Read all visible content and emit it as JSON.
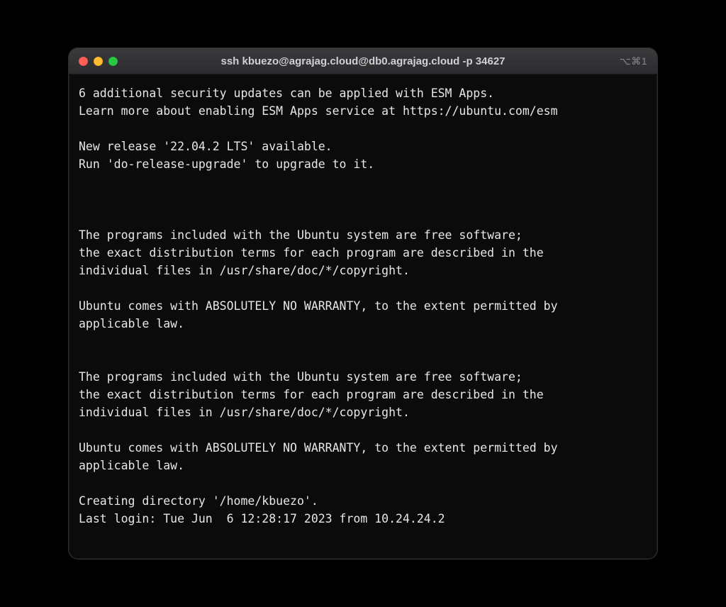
{
  "window": {
    "title": "ssh kbuezo@agrajag.cloud@db0.agrajag.cloud -p 34627",
    "shortcut_hint": "⌥⌘1"
  },
  "terminal": {
    "lines": [
      "6 additional security updates can be applied with ESM Apps.",
      "Learn more about enabling ESM Apps service at https://ubuntu.com/esm",
      "",
      "New release '22.04.2 LTS' available.",
      "Run 'do-release-upgrade' to upgrade to it.",
      "",
      "",
      "",
      "The programs included with the Ubuntu system are free software;",
      "the exact distribution terms for each program are described in the",
      "individual files in /usr/share/doc/*/copyright.",
      "",
      "Ubuntu comes with ABSOLUTELY NO WARRANTY, to the extent permitted by",
      "applicable law.",
      "",
      "",
      "The programs included with the Ubuntu system are free software;",
      "the exact distribution terms for each program are described in the",
      "individual files in /usr/share/doc/*/copyright.",
      "",
      "Ubuntu comes with ABSOLUTELY NO WARRANTY, to the extent permitted by",
      "applicable law.",
      "",
      "Creating directory '/home/kbuezo'.",
      "Last login: Tue Jun  6 12:28:17 2023 from 10.24.24.2"
    ]
  }
}
